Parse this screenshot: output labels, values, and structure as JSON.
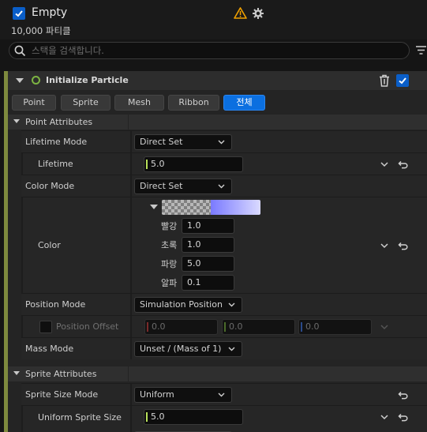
{
  "header": {
    "emitter_name": "Empty",
    "particle_count": "10,000 파티클",
    "enabled": true
  },
  "search": {
    "placeholder": "스택을 검색합니다.",
    "value": ""
  },
  "module": {
    "title": "Initialize Particle",
    "enabled": true,
    "accent_color": "#7e8a3e",
    "tabs": [
      {
        "label": "Point"
      },
      {
        "label": "Sprite"
      },
      {
        "label": "Mesh"
      },
      {
        "label": "Ribbon"
      },
      {
        "label": "전체",
        "active": true
      }
    ]
  },
  "point_attributes": {
    "title": "Point Attributes",
    "lifetime_mode": {
      "label": "Lifetime Mode",
      "value": "Direct Set"
    },
    "lifetime": {
      "label": "Lifetime",
      "value": "5.0"
    },
    "color_mode": {
      "label": "Color Mode",
      "value": "Direct Set"
    },
    "color": {
      "label": "Color",
      "channels": [
        {
          "label": "빨강",
          "value": "1.0"
        },
        {
          "label": "초록",
          "value": "1.0"
        },
        {
          "label": "파랑",
          "value": "5.0"
        },
        {
          "label": "알파",
          "value": "0.1"
        }
      ]
    },
    "position_mode": {
      "label": "Position Mode",
      "value": "Simulation Position"
    },
    "position_offset": {
      "label": "Position Offset",
      "x": "0.0",
      "y": "0.0",
      "z": "0.0",
      "enabled": false
    },
    "mass_mode": {
      "label": "Mass Mode",
      "value": "Unset / (Mass of 1)"
    }
  },
  "sprite_attributes": {
    "title": "Sprite Attributes",
    "size_mode": {
      "label": "Sprite Size Mode",
      "value": "Uniform"
    },
    "uniform_size": {
      "label": "Uniform Sprite Size",
      "value": "5.0"
    }
  },
  "colors": {
    "accent_blue": "#0b6fe0",
    "warning": "#f0a000",
    "status_green": "#7cb342"
  }
}
